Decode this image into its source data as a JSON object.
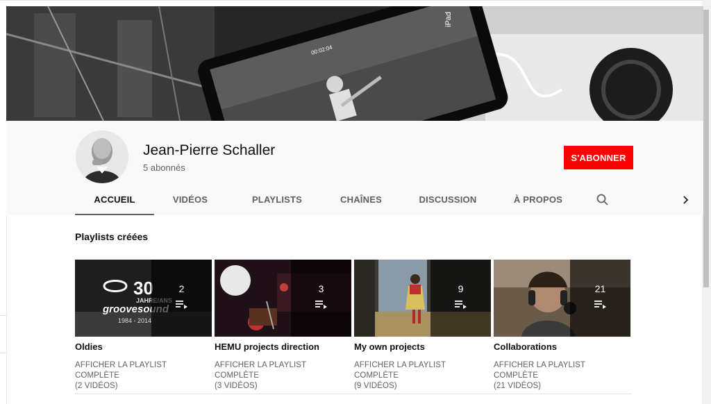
{
  "channel": {
    "name": "Jean-Pierre Schaller",
    "subscribers": "5 abonnés",
    "subscribe_label": "S'ABONNER"
  },
  "tabs": [
    {
      "label": "ACCUEIL",
      "active": true
    },
    {
      "label": "VIDÉOS",
      "active": false
    },
    {
      "label": "PLAYLISTS",
      "active": false
    },
    {
      "label": "CHAÎNES",
      "active": false
    },
    {
      "label": "DISCUSSION",
      "active": false
    },
    {
      "label": "À PROPOS",
      "active": false
    }
  ],
  "banner": {
    "ipad_label": "iPad",
    "timer": "00:02:04"
  },
  "section": {
    "title": "Playlists créées"
  },
  "playlists": [
    {
      "title": "Oldies",
      "count": "2",
      "link": "AFFICHER LA PLAYLIST COMPLÈTE",
      "videos": "(2 VIDÉOS)",
      "thumb_text": {
        "big": "30",
        "line1": "JAHRE/ANS",
        "line2": "groovesound",
        "line3": "1984 - 2014"
      }
    },
    {
      "title": "HEMU projects direction",
      "count": "3",
      "link": "AFFICHER LA PLAYLIST COMPLÈTE",
      "videos": "(3 VIDÉOS)"
    },
    {
      "title": "My own projects",
      "count": "9",
      "link": "AFFICHER LA PLAYLIST COMPLÈTE",
      "videos": "(9 VIDÉOS)"
    },
    {
      "title": "Collaborations",
      "count": "21",
      "link": "AFFICHER LA PLAYLIST COMPLÈTE",
      "videos": "(21 VIDÉOS)"
    }
  ],
  "colors": {
    "accent": "#ff0000",
    "text": "#0f0f0f",
    "secondary": "#606060"
  },
  "icons": {
    "search": "search-icon",
    "next": "chevron-right-icon",
    "playlist": "playlist-play-icon"
  }
}
